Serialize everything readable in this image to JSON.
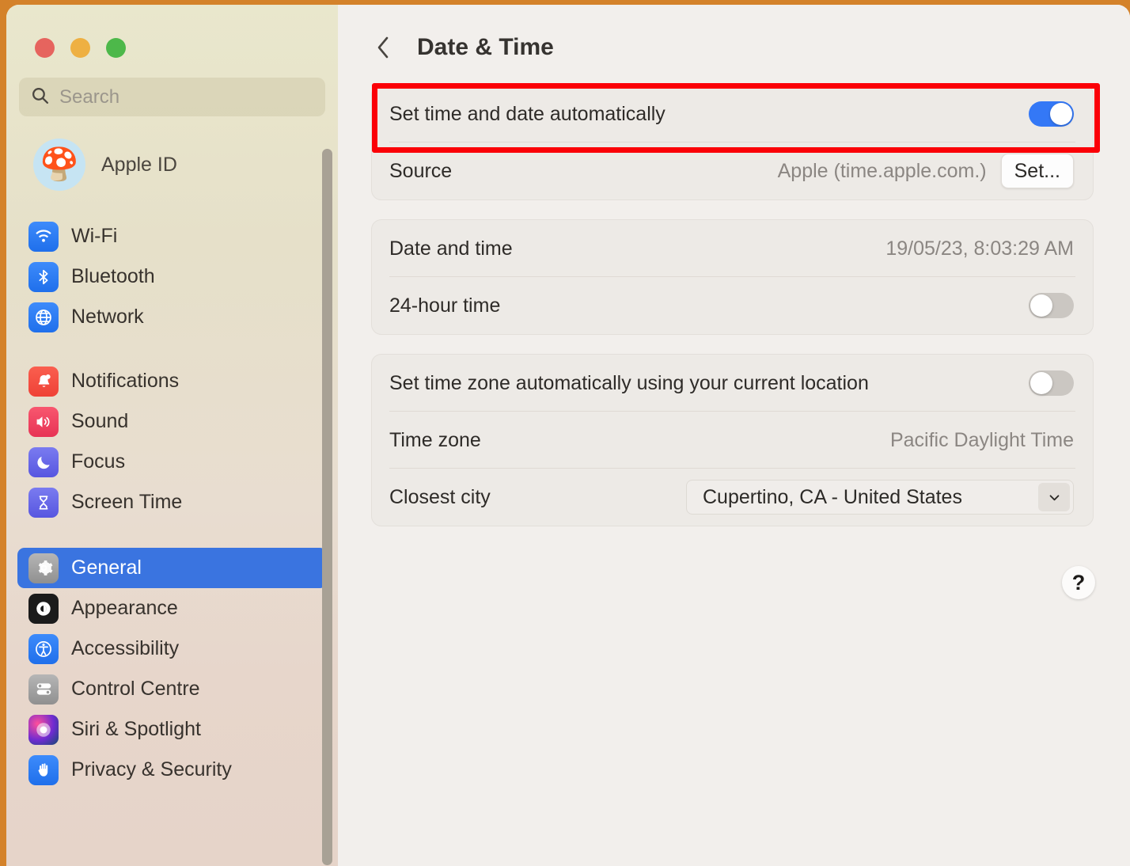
{
  "window": {
    "traffic_lights": [
      "close",
      "minimize",
      "zoom"
    ],
    "accent_blue": "#3478f6",
    "selected_blue": "#3a74e0",
    "highlight_color": "#fb0007",
    "panel_bg": "#f2efec",
    "card_bg": "#edeae6"
  },
  "sidebar": {
    "search": {
      "placeholder": "Search",
      "value": ""
    },
    "account": {
      "name": "Apple ID",
      "avatar_glyph": "🍄"
    },
    "groups": [
      {
        "items": [
          {
            "label": "Wi-Fi",
            "icon": "wifi-icon",
            "selected": false
          },
          {
            "label": "Bluetooth",
            "icon": "bluetooth-icon",
            "selected": false
          },
          {
            "label": "Network",
            "icon": "network-icon",
            "selected": false
          }
        ]
      },
      {
        "items": [
          {
            "label": "Notifications",
            "icon": "bell-icon",
            "selected": false
          },
          {
            "label": "Sound",
            "icon": "speaker-icon",
            "selected": false
          },
          {
            "label": "Focus",
            "icon": "moon-icon",
            "selected": false
          },
          {
            "label": "Screen Time",
            "icon": "hourglass-icon",
            "selected": false
          }
        ]
      },
      {
        "items": [
          {
            "label": "General",
            "icon": "gear-icon",
            "selected": true
          },
          {
            "label": "Appearance",
            "icon": "appearance-icon",
            "selected": false
          },
          {
            "label": "Accessibility",
            "icon": "accessibility-icon",
            "selected": false
          },
          {
            "label": "Control Centre",
            "icon": "control-centre-icon",
            "selected": false
          },
          {
            "label": "Siri & Spotlight",
            "icon": "siri-icon",
            "selected": false
          },
          {
            "label": "Privacy & Security",
            "icon": "hand-icon",
            "selected": false
          }
        ]
      }
    ]
  },
  "main": {
    "back_label": "Back",
    "title": "Date & Time",
    "sections": [
      {
        "rows": [
          {
            "label": "Set time and date automatically",
            "control": "toggle",
            "toggle_on": true,
            "highlighted": true
          },
          {
            "label": "Source",
            "value": "Apple (time.apple.com.)",
            "button": "Set..."
          }
        ]
      },
      {
        "rows": [
          {
            "label": "Date and time",
            "value": "19/05/23, 8:03:29 AM"
          },
          {
            "label": "24-hour time",
            "control": "toggle",
            "toggle_on": false
          }
        ]
      },
      {
        "rows": [
          {
            "label": "Set time zone automatically using your current location",
            "control": "toggle",
            "toggle_on": false
          },
          {
            "label": "Time zone",
            "value": "Pacific Daylight Time"
          },
          {
            "label": "Closest city",
            "dropdown_value": "Cupertino, CA - United States"
          }
        ]
      }
    ],
    "help_label": "?"
  }
}
